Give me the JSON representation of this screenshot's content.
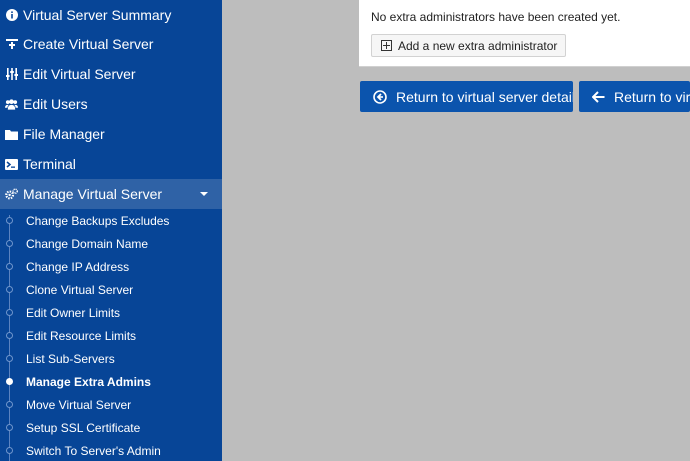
{
  "sidebar": {
    "items": [
      {
        "label": "Virtual Server Summary",
        "icon": "info-circle-icon"
      },
      {
        "label": "Create Virtual Server",
        "icon": "create-server-icon"
      },
      {
        "label": "Edit Virtual Server",
        "icon": "sliders-icon"
      },
      {
        "label": "Edit Users",
        "icon": "users-icon"
      },
      {
        "label": "File Manager",
        "icon": "folder-icon"
      },
      {
        "label": "Terminal",
        "icon": "terminal-icon"
      },
      {
        "label": "Manage Virtual Server",
        "icon": "cogs-icon"
      }
    ],
    "subitems": [
      {
        "label": "Change Backups Excludes"
      },
      {
        "label": "Change Domain Name"
      },
      {
        "label": "Change IP Address"
      },
      {
        "label": "Clone Virtual Server"
      },
      {
        "label": "Edit Owner Limits"
      },
      {
        "label": "Edit Resource Limits"
      },
      {
        "label": "List Sub-Servers"
      },
      {
        "label": "Manage Extra Admins",
        "active": true
      },
      {
        "label": "Move Virtual Server"
      },
      {
        "label": "Setup SSL Certificate"
      },
      {
        "label": "Switch To Server's Admin"
      }
    ]
  },
  "main": {
    "empty_message": "No extra administrators have been created yet.",
    "add_button": "Add a new extra administrator",
    "return_buttons": [
      {
        "label": "Return to virtual server details",
        "icon": "circle-arrow-left-icon"
      },
      {
        "label": "Return to virtual",
        "icon": "arrow-left-icon"
      }
    ]
  },
  "colors": {
    "sidebar_bg": "#074597",
    "sidebar_active": "#2f62a6",
    "button_blue": "#0b54ad",
    "content_bg": "#bdbdbd"
  }
}
